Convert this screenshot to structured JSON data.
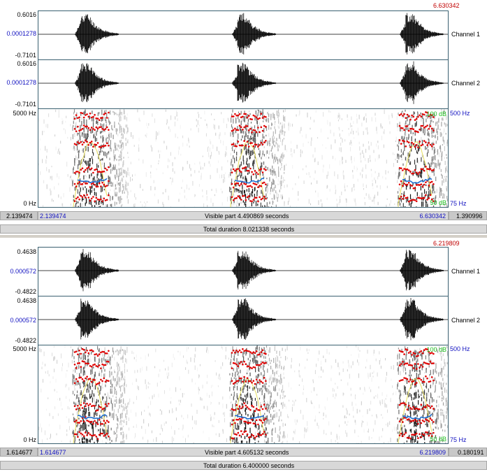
{
  "panels": [
    {
      "id": "top",
      "window_end_red": "6.630342",
      "channel1": {
        "max": "0.6016",
        "center": "0.0001278",
        "min": "-0.7101",
        "label": "Channel 1"
      },
      "channel2": {
        "max": "0.6016",
        "center": "0.0001278",
        "min": "-0.7101",
        "label": "Channel 2"
      },
      "spectrogram": {
        "freq_top": "5000 Hz",
        "freq_bottom": "0 Hz",
        "db_top": "100 dB",
        "db_bottom": "50 dB",
        "pitch_top": "500 Hz",
        "pitch_bottom": "75 Hz"
      },
      "visible_start": "2.139474",
      "visible_end": "6.630342",
      "left_hidden": "2.139474",
      "right_hidden": "1.390996",
      "visible_part": "Visible part 4.490869 seconds",
      "total_duration": "Total duration 8.021338 seconds"
    },
    {
      "id": "bottom",
      "window_end_red": "6.219809",
      "channel1": {
        "max": "0.4638",
        "center": "0.000572",
        "min": "-0.4822",
        "label": "Channel 1"
      },
      "channel2": {
        "max": "0.4638",
        "center": "0.000572",
        "min": "-0.4822",
        "label": "Channel 2"
      },
      "spectrogram": {
        "freq_top": "5000 Hz",
        "freq_bottom": "0 Hz",
        "db_top": "100 dB",
        "db_bottom": "50 dB",
        "pitch_top": "500 Hz",
        "pitch_bottom": "75 Hz"
      },
      "visible_start": "1.614677",
      "visible_end": "6.219809",
      "left_hidden": "1.614677",
      "right_hidden": "0.180191",
      "visible_part": "Visible part 4.605132 seconds",
      "total_duration": "Total duration 6.400000 seconds"
    }
  ],
  "colors": {
    "formant": "#e00000",
    "pitch": "#1f6fd0",
    "intensity": "#e8e060",
    "frame": "#3a6070",
    "time_red": "#c00000",
    "axis_blue": "#1010c0",
    "db_green": "#20c020"
  }
}
